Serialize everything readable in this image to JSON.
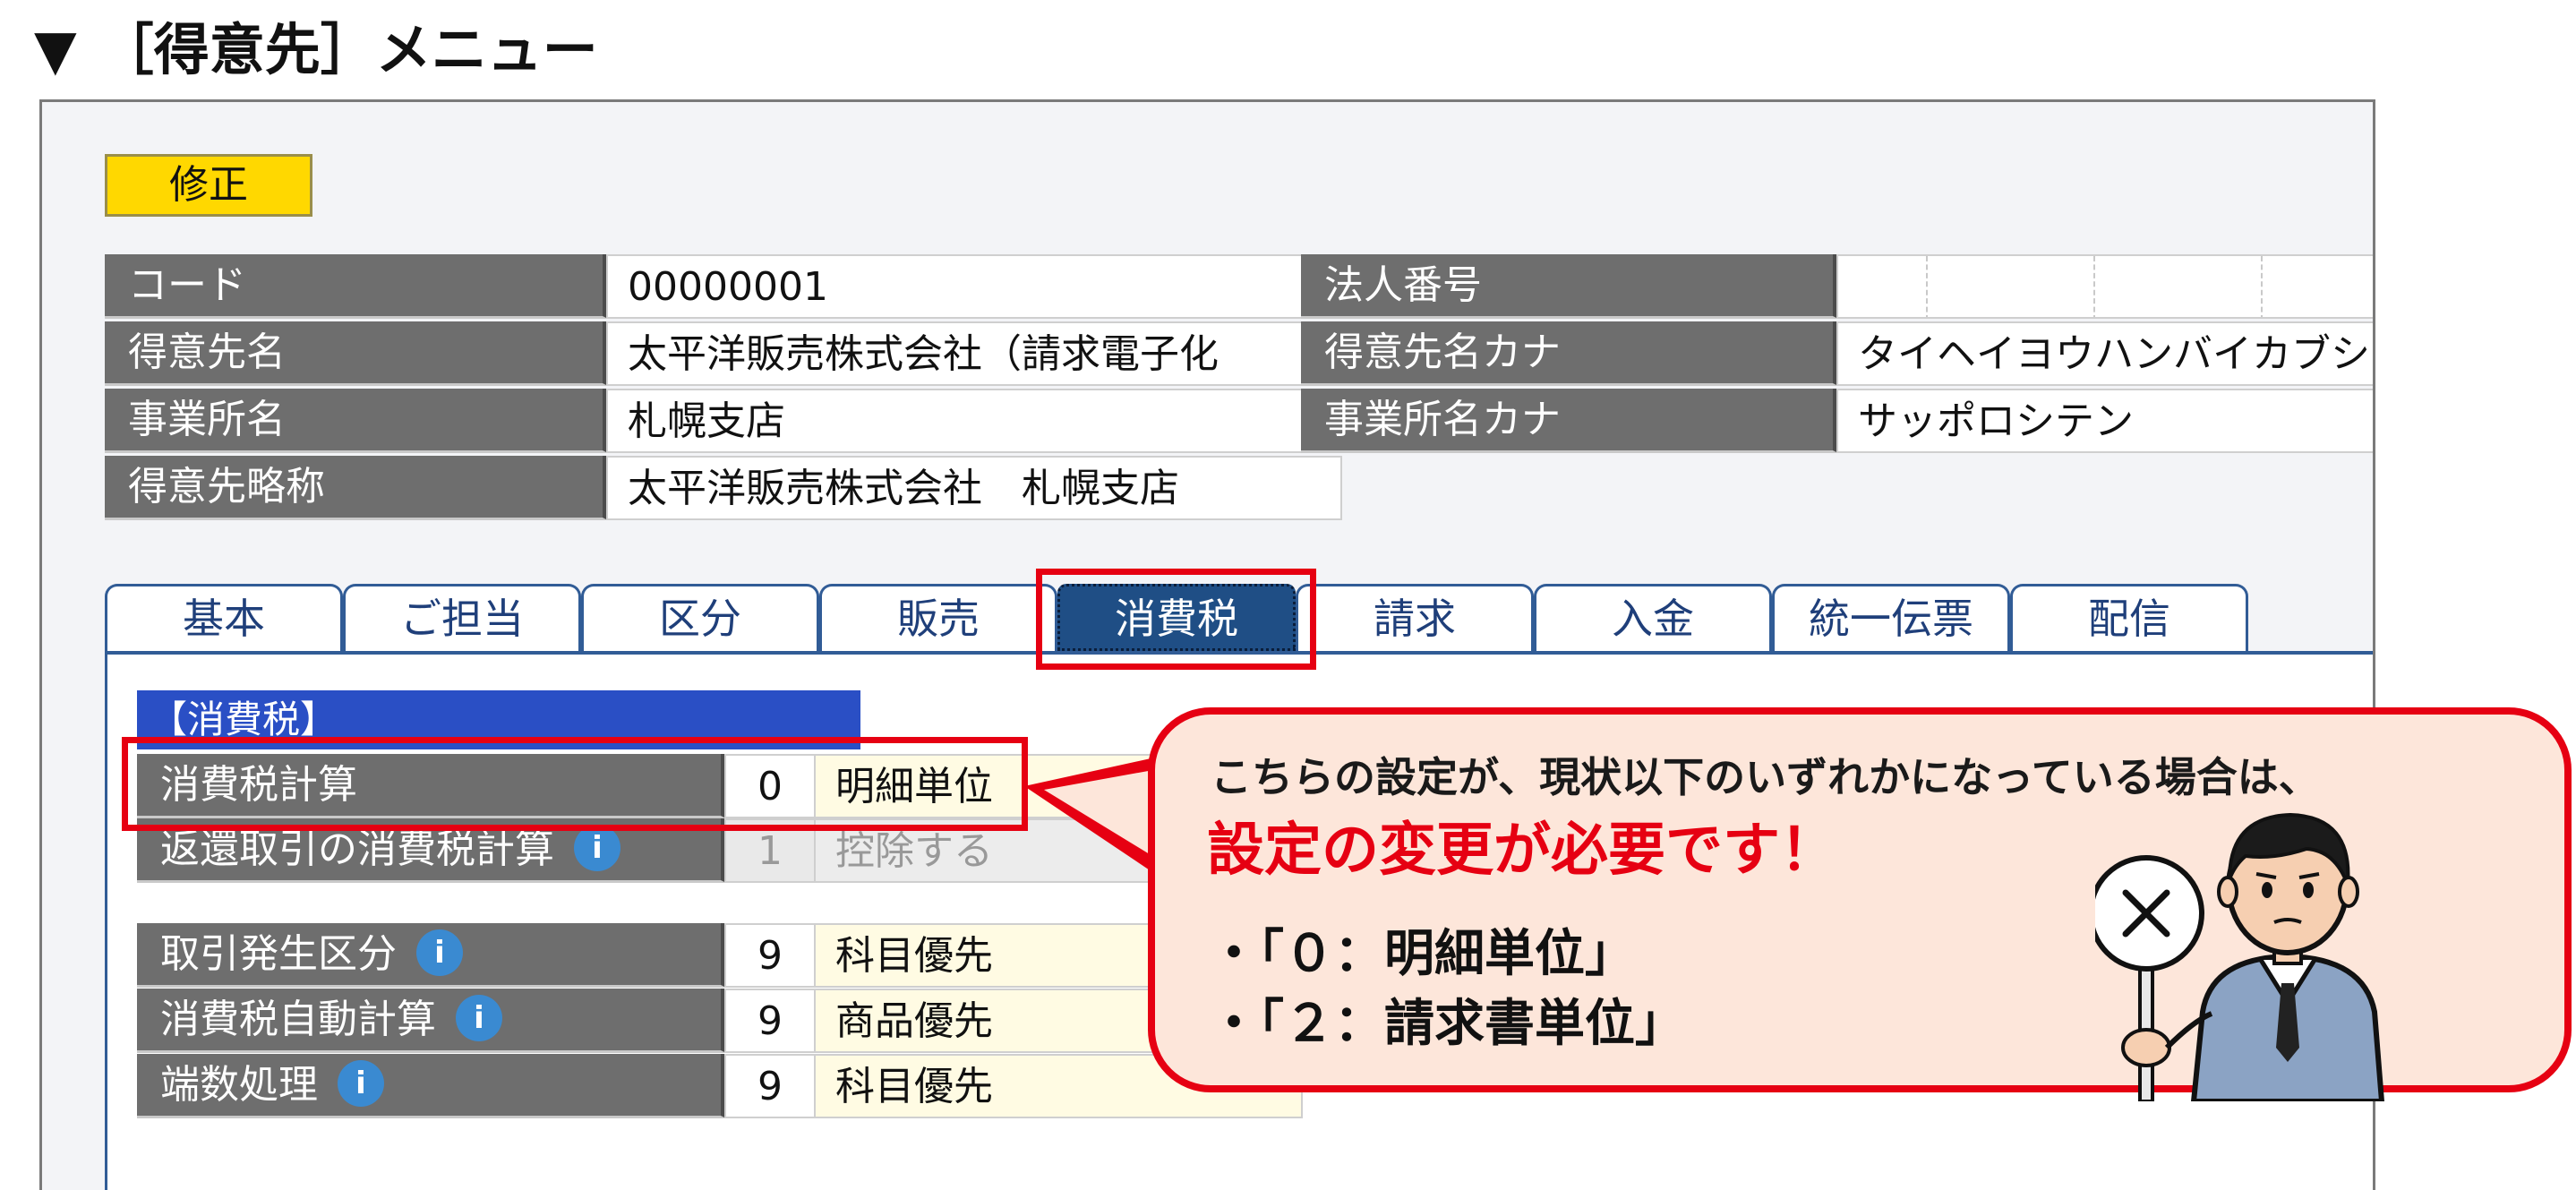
{
  "heading": {
    "marker": "▼",
    "text": "［得意先］メニュー"
  },
  "toolbar": {
    "edit_label": "修正"
  },
  "customer": {
    "code_label": "コード",
    "code_value": "00000001",
    "name_label": "得意先名",
    "name_value": "太平洋販売株式会社（請求電子化",
    "office_label": "事業所名",
    "office_value": "札幌支店",
    "short_label": "得意先略称",
    "short_value": "太平洋販売株式会社　札幌支店",
    "corp_no_label": "法人番号",
    "corp_no_value": "",
    "kana_label": "得意先名カナ",
    "kana_value": "タイヘイヨウハンバイカブシ",
    "office_kana_label": "事業所名カナ",
    "office_kana_value": "サッポロシテン"
  },
  "tabs": [
    {
      "label": "基本",
      "active": false
    },
    {
      "label": "ご担当",
      "active": false
    },
    {
      "label": "区分",
      "active": false
    },
    {
      "label": "販売",
      "active": false
    },
    {
      "label": "消費税",
      "active": true
    },
    {
      "label": "請求",
      "active": false
    },
    {
      "label": "入金",
      "active": false
    },
    {
      "label": "統一伝票",
      "active": false
    },
    {
      "label": "配信",
      "active": false
    }
  ],
  "tax_section": {
    "title": "【消費税】",
    "rows": [
      {
        "label": "消費税計算",
        "info": false,
        "code": "0",
        "value": "明細単位",
        "disabled": false
      },
      {
        "label": "返還取引の消費税計算",
        "info": true,
        "code": "1",
        "value": "控除する",
        "disabled": true
      },
      {
        "label": "取引発生区分",
        "info": true,
        "code": "9",
        "value": "科目優先",
        "disabled": false
      },
      {
        "label": "消費税自動計算",
        "info": true,
        "code": "9",
        "value": "商品優先",
        "disabled": false
      },
      {
        "label": "端数処理",
        "info": true,
        "code": "9",
        "value": "科目優先",
        "disabled": false
      }
    ],
    "info_glyph": "i"
  },
  "callout": {
    "line1": "こちらの設定が、現状以下のいずれかになっている場合は、",
    "line2": "設定の変更が必要です！",
    "items": [
      "・「０：明細単位」",
      "・「２：請求書単位」"
    ],
    "icon": "no-sign-person-icon"
  },
  "colors": {
    "accent_red": "#e60012",
    "edit_button": "#ffd800",
    "tab_active": "#1f4e85",
    "section_header": "#2a4fc5",
    "label_bg": "#6e6e6e"
  }
}
